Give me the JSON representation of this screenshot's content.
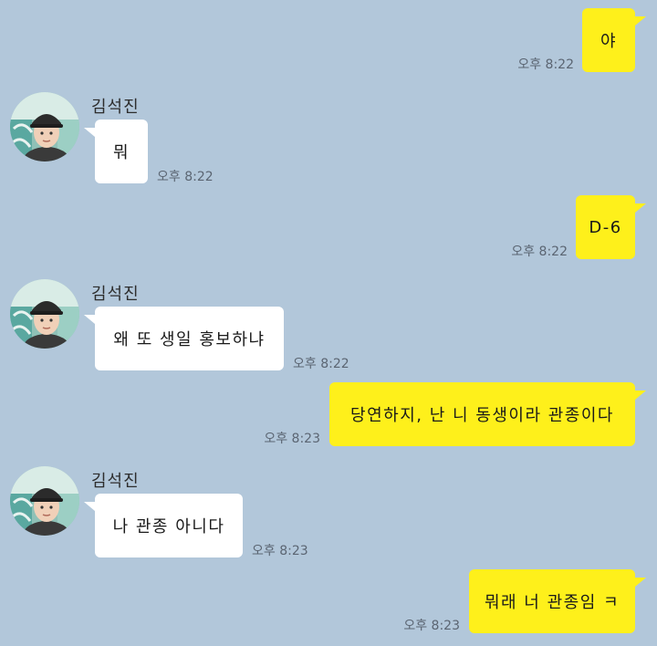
{
  "chat": {
    "contact_name": "김석진",
    "colors": {
      "background": "#b2c7da",
      "my_bubble": "#fef01b",
      "their_bubble": "#ffffff",
      "timestamp": "#5b6572"
    },
    "messages": [
      {
        "sender": "me",
        "text": "야",
        "time": "오후 8:22"
      },
      {
        "sender": "other",
        "text": "뭐",
        "time": "오후 8:22"
      },
      {
        "sender": "me",
        "text": "D-6",
        "time": "오후 8:22"
      },
      {
        "sender": "other",
        "text": "왜 또 생일 홍보하냐",
        "time": "오후 8:22"
      },
      {
        "sender": "me",
        "text": "당연하지, 난 니 동생이라 관종이다",
        "time": "오후 8:23"
      },
      {
        "sender": "other",
        "text": "나 관종 아니다",
        "time": "오후 8:23"
      },
      {
        "sender": "me",
        "text": "뭐래 너 관종임 ㅋ",
        "time": "오후 8:23"
      }
    ]
  }
}
